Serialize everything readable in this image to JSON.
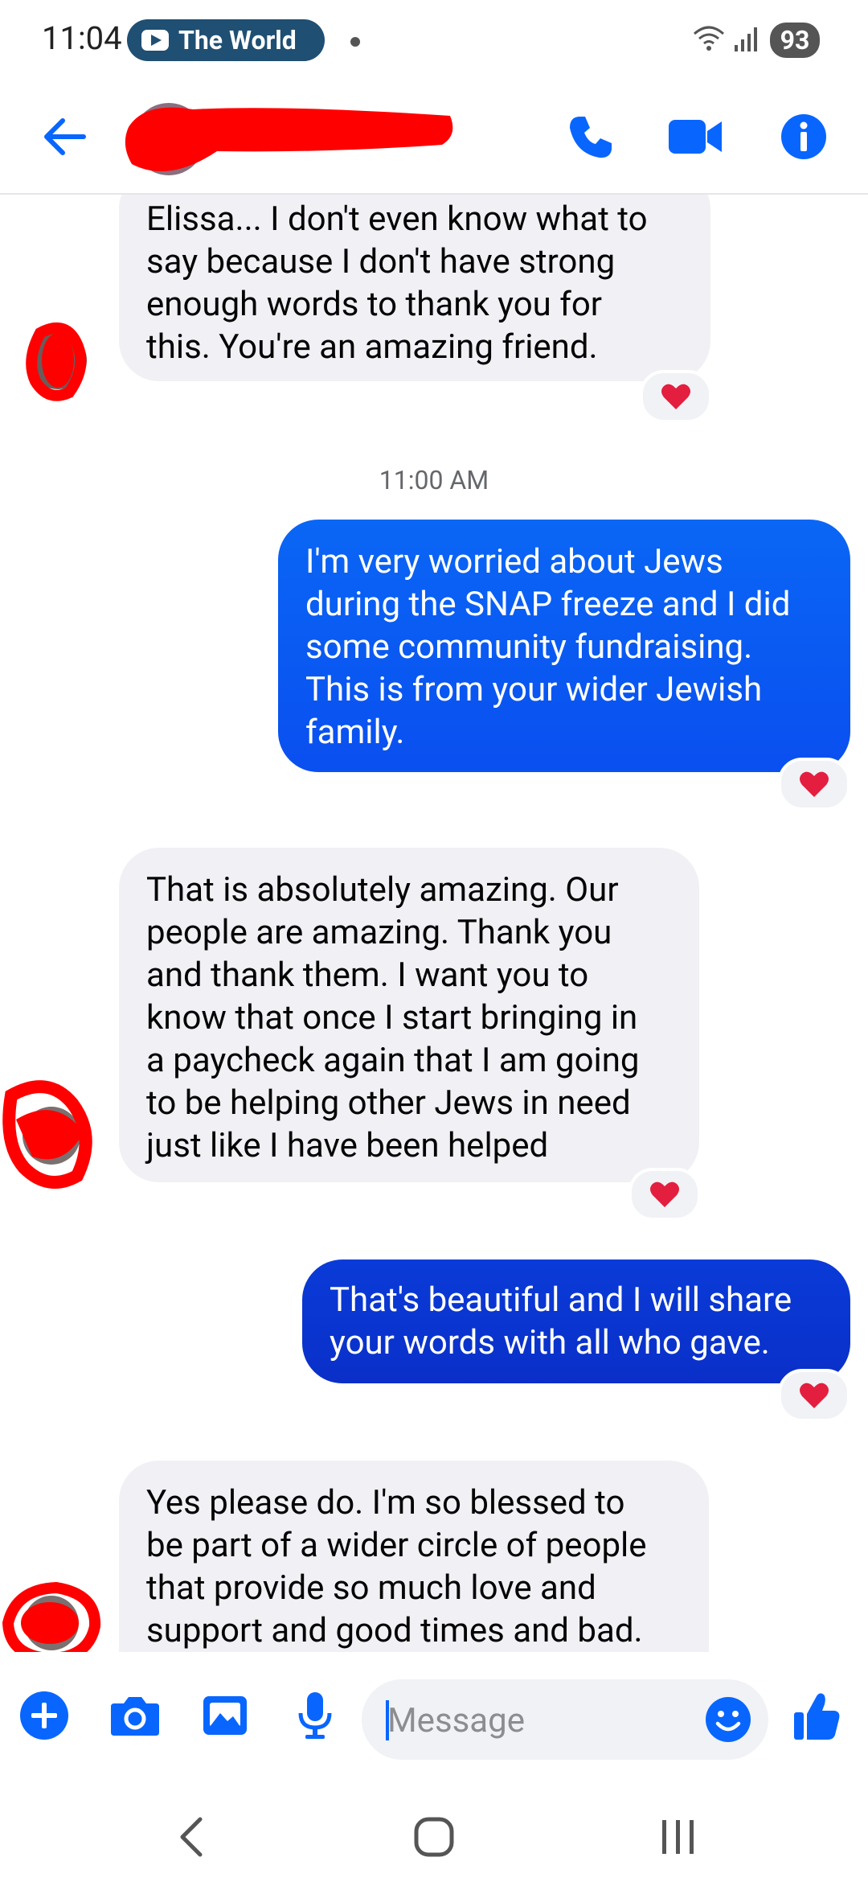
{
  "status_bar": {
    "time": "11:04",
    "media_pill": "The World",
    "battery": "93"
  },
  "header": {
    "back_icon": "arrow-left-icon",
    "contact_name_redacted": true,
    "icons": [
      "phone-icon",
      "video-camera-icon",
      "info-icon"
    ],
    "accent": "#0866ff"
  },
  "messages": [
    {
      "direction": "incoming",
      "text": "Elissa... I don't even know what to\nsay because I don't have strong\nenough words to thank you for\nthis. You're an amazing friend.",
      "reaction": "❤️"
    },
    {
      "type": "timestamp",
      "text": "11:00 AM"
    },
    {
      "direction": "outgoing",
      "text": "I'm very worried about Jews\nduring the SNAP freeze and I did\nsome community fundraising.\nThis is from your wider Jewish\nfamily.",
      "reaction": "❤️"
    },
    {
      "direction": "incoming",
      "text": "That is absolutely amazing. Our\npeople are amazing. Thank you\nand thank them. I want you to\nknow that once I start bringing in\na paycheck again that I am going\nto be helping other Jews in need\njust like I have been helped",
      "reaction": "❤️"
    },
    {
      "direction": "outgoing",
      "text": "That's beautiful and I will share\nyour words with all who gave.",
      "reaction": "❤️"
    },
    {
      "direction": "incoming",
      "text": "Yes please do. I'm so blessed to\nbe part of a wider circle of people\nthat provide so much love and\nsupport and good times and bad.",
      "reaction": ""
    }
  ],
  "colors": {
    "outgoing_top": "#0a66f5",
    "outgoing_bottom": "#0a2fd0",
    "incoming": "#f0f0f5",
    "heart": "#e41e3f",
    "redaction": "#ff0000"
  },
  "composer": {
    "placeholder": "Message",
    "icons": [
      "plus-icon",
      "camera-icon",
      "image-icon",
      "microphone-icon",
      "emoji-icon",
      "thumbs-up-icon"
    ]
  },
  "nav_bar": {
    "icons": [
      "back-chevron-icon",
      "home-icon",
      "recents-icon"
    ]
  }
}
